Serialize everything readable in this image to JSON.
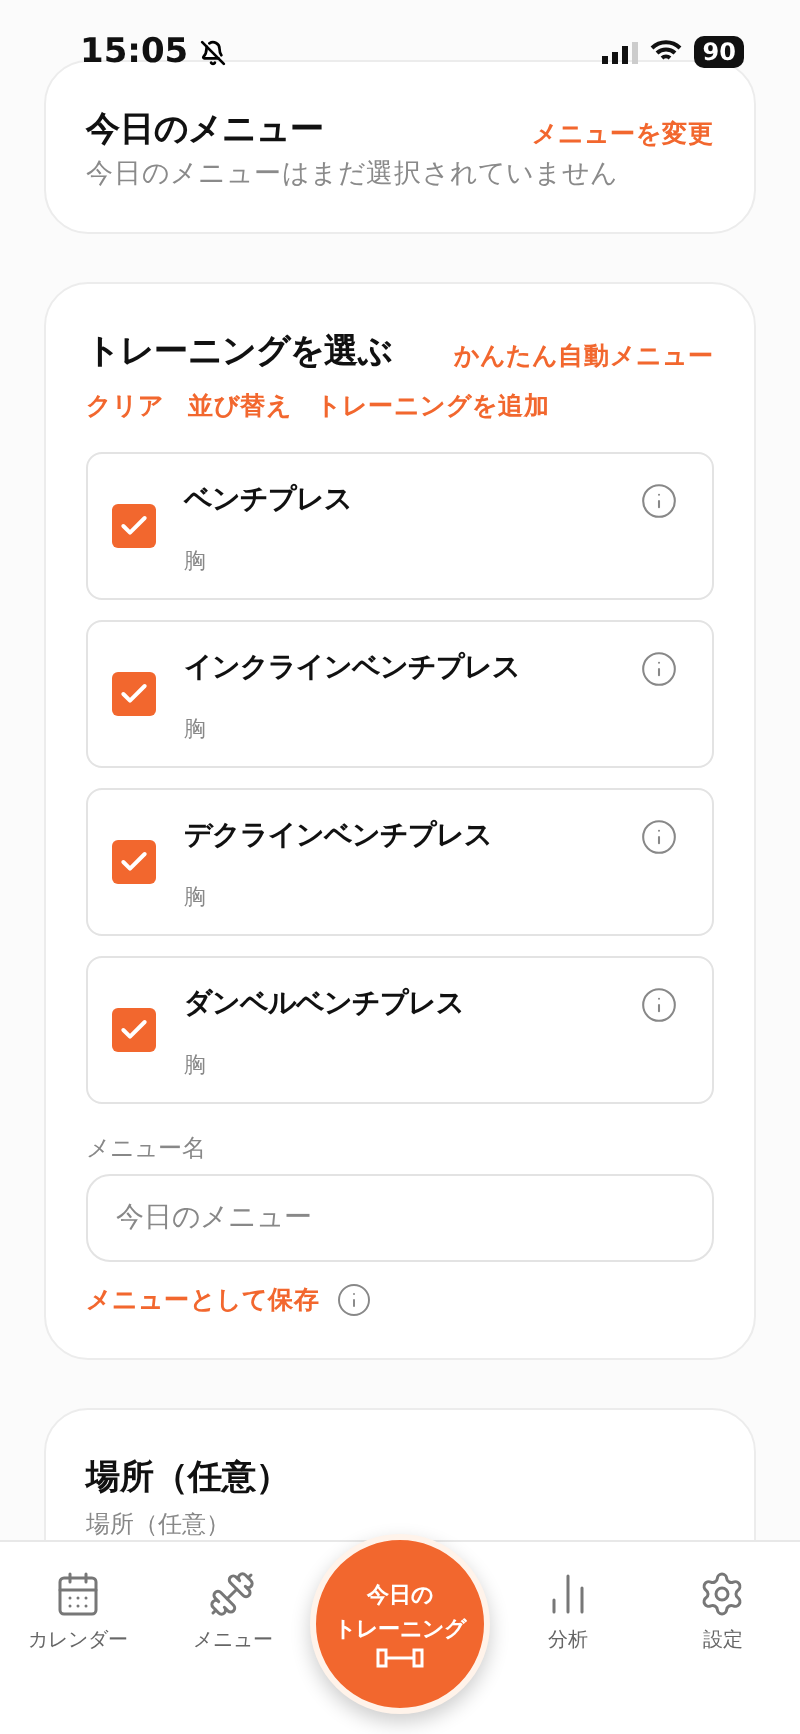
{
  "status_bar": {
    "time": "15:05",
    "battery": "90",
    "muted": true
  },
  "today_card": {
    "title": "今日のメニュー",
    "action": "メニューを変更",
    "subtitle": "今日のメニューはまだ選択されていません"
  },
  "training_card": {
    "title": "トレーニングを選ぶ",
    "action": "かんたん自動メニュー",
    "links": [
      "クリア",
      "並び替え",
      "トレーニングを追加"
    ],
    "exercises": [
      {
        "name": "ベンチプレス",
        "part": "胸",
        "checked": true
      },
      {
        "name": "インクラインベンチプレス",
        "part": "胸",
        "checked": true
      },
      {
        "name": "デクラインベンチプレス",
        "part": "胸",
        "checked": true
      },
      {
        "name": "ダンベルベンチプレス",
        "part": "胸",
        "checked": true
      }
    ],
    "menu_name": {
      "label": "メニュー名",
      "placeholder": "今日のメニュー"
    },
    "save": "メニューとして保存"
  },
  "place_card": {
    "title": "場所（任意）",
    "label": "場所（任意）"
  },
  "tab_bar": {
    "items": [
      {
        "kind": "calendar",
        "label": "カレンダー"
      },
      {
        "kind": "menu",
        "label": "メニュー"
      },
      {
        "kind": "center",
        "label_lines": [
          "今日の",
          "トレーニング"
        ]
      },
      {
        "kind": "analysis",
        "label": "分析"
      },
      {
        "kind": "settings",
        "label": "設定"
      }
    ]
  }
}
